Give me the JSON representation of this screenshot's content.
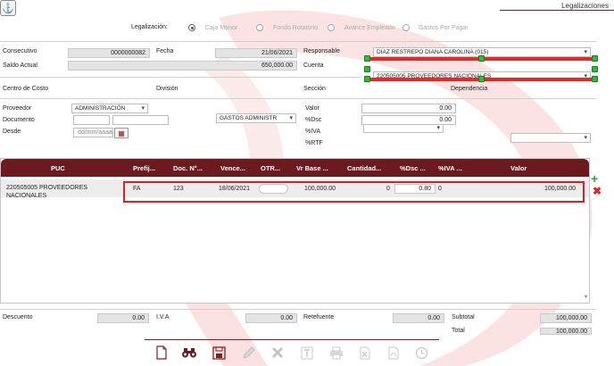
{
  "window": {
    "title": "Legalizaciones",
    "top_icon": "anchor-icon"
  },
  "legalizacion": {
    "label": "Legalización:",
    "options": [
      {
        "label": "Caja Menor",
        "selected": true
      },
      {
        "label": "Fondo Rotatorio",
        "selected": false
      },
      {
        "label": "Avance Empleado",
        "selected": false
      },
      {
        "label": "Gastos Por Pagar",
        "selected": false
      }
    ]
  },
  "form": {
    "consecutivo_label": "Consecutivo",
    "consecutivo_value": "0000000082",
    "fecha_label": "Fecha",
    "fecha_value": "21/06/2021",
    "saldo_label": "Saldo Actual",
    "saldo_value": "650,000.00",
    "responsable_label": "Responsable",
    "responsable_value": "DIAZ RESTREPO DIANA CAROLINA (015)",
    "cuenta_label": "Cuenta",
    "cuenta_value": "220505005 PROVEEDORES NACIONALES",
    "centro_costo_label": "Centro de Costo",
    "centro_costo_value": "ADMINISTRACIÓN",
    "division_label": "División",
    "division_value": "GASTOS ADMINISTR",
    "seccion_label": "Sección",
    "seccion_value": "",
    "dependencia_label": "Dependencia",
    "dependencia_value": "",
    "proveedor_label": "Proveedor",
    "proveedor_value": "",
    "documento_label": "Documento",
    "documento_value": "",
    "desde_label": "Desde",
    "desde_placeholder": "dd/mm/aaaa",
    "valor_label": "Valor",
    "valor_value": "0.00",
    "dsc_label": "%Dsc",
    "dsc_value": "0.00",
    "iva_label": "%IVA",
    "iva_value": "",
    "rtf_label": "%RTF",
    "rtf_value": ""
  },
  "grid": {
    "headers": [
      "PUC",
      "Prefij...",
      "Doc. N°...",
      "Vence...",
      "OTR...",
      "Vr Base ...",
      "Cantidad...",
      "%Dsc ...",
      "%IVA ...",
      "Valor"
    ],
    "rows": [
      {
        "puc": "220505005 PROVEEDORES",
        "puc2": "NACIONALES",
        "prefijo": "FA",
        "doc": "123",
        "vence": "18/06/2021",
        "otr": "",
        "vr_base": "100,000.00",
        "cantidad": "0",
        "dsc": "0.80",
        "iva": "0",
        "valor": "100,000.00"
      }
    ]
  },
  "totals": {
    "descuento_label": "Descuento",
    "descuento_value": "0.00",
    "iva_label": "I.V.A",
    "iva_value": "0.00",
    "retefuente_label": "Retefuente",
    "retefuente_value": "0.00",
    "subtotal_label": "Subtotal",
    "subtotal_value": "100,000.00",
    "total_label": "Total",
    "total_value": "100,000.00"
  },
  "toolbar": [
    "new-document-icon",
    "search-binoculars-icon",
    "save-icon",
    "edit-icon",
    "delete-icon",
    "text-icon",
    "print-icon",
    "export-excel-icon",
    "export-pdf-icon",
    "history-icon"
  ],
  "colors": {
    "accent": "#6b1a1f",
    "highlight": "#e02020",
    "handle": "#2ebd3a"
  }
}
